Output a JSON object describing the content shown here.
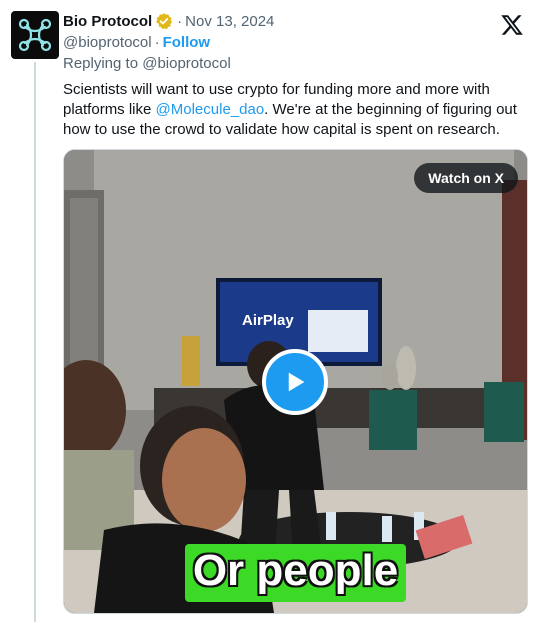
{
  "author": {
    "name": "Bio Protocol",
    "handle": "@bioprotocol",
    "date": "Nov 13, 2024",
    "follow_label": "Follow",
    "verified_color": "#e2b719",
    "avatar_icon": "bio-protocol-logo-icon"
  },
  "separator": "·",
  "reply": {
    "prefix": "Replying to",
    "handle": "@bioprotocol"
  },
  "tweet": {
    "text_part1": "Scientists will want to use crypto for funding more and more with platforms like ",
    "mention": "@Molecule_dao",
    "text_part2": ". We're at the beginning of figuring out how to use the crowd to validate how capital is spent on research."
  },
  "video": {
    "watch_label": "Watch on X",
    "caption": "Or people",
    "tv_text": "AirPlay",
    "play_icon": "play-icon",
    "caption_color": "#3cd926"
  },
  "colors": {
    "accent": "#1d9bf0",
    "text": "#0f1419",
    "muted": "#536471"
  }
}
